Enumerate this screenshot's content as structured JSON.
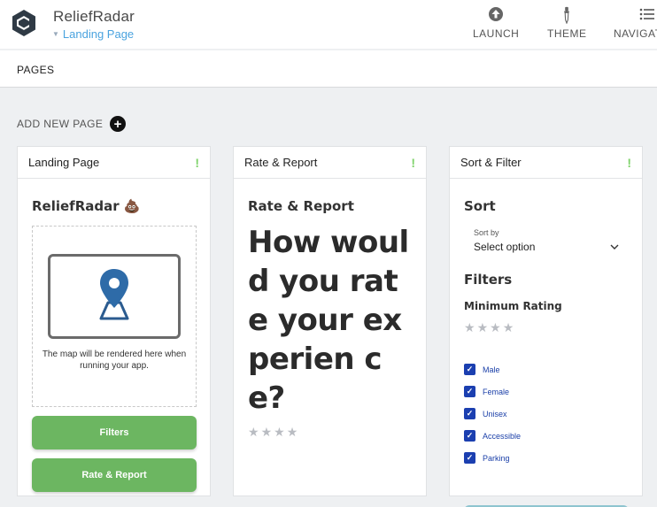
{
  "app": {
    "title": "ReliefRadar",
    "current_page": "Landing Page"
  },
  "top_actions": [
    {
      "label": "LAUNCH",
      "icon": "upload-circle-icon"
    },
    {
      "label": "THEME",
      "icon": "eyedropper-icon"
    },
    {
      "label": "NAVIGAT",
      "icon": "list-icon"
    }
  ],
  "pages_bar": {
    "label": "PAGES"
  },
  "add_page": {
    "label": "ADD NEW PAGE",
    "icon": "plus-circle-icon"
  },
  "columns": [
    {
      "header": "Landing Page",
      "flag": "!",
      "brand": "ReliefRadar 💩",
      "map_text": "The map will be rendered here when running your app.",
      "buttons": [
        "Filters",
        "Rate & Report"
      ]
    },
    {
      "header": "Rate & Report",
      "flag": "!",
      "title": "Rate & Report",
      "question": "How would you rate your experien ce?",
      "rating": {
        "value": 0,
        "max": 4
      }
    },
    {
      "header": "Sort & Filter",
      "flag": "!",
      "sort_title": "Sort",
      "sort_by_label": "Sort by",
      "sort_placeholder": "Select option",
      "filters_title": "Filters",
      "min_rating_label": "Minimum Rating",
      "min_rating": {
        "value": 0,
        "max": 4
      },
      "checkboxes": [
        {
          "label": "Male",
          "checked": true
        },
        {
          "label": "Female",
          "checked": true
        },
        {
          "label": "Unisex",
          "checked": true
        },
        {
          "label": "Accessible",
          "checked": true
        },
        {
          "label": "Parking",
          "checked": true
        }
      ]
    }
  ],
  "colors": {
    "accent_blue": "#4aa3df",
    "button_green": "#6cb661",
    "status_green": "#7fd36b",
    "checkbox_blue": "#1b3fb0"
  }
}
